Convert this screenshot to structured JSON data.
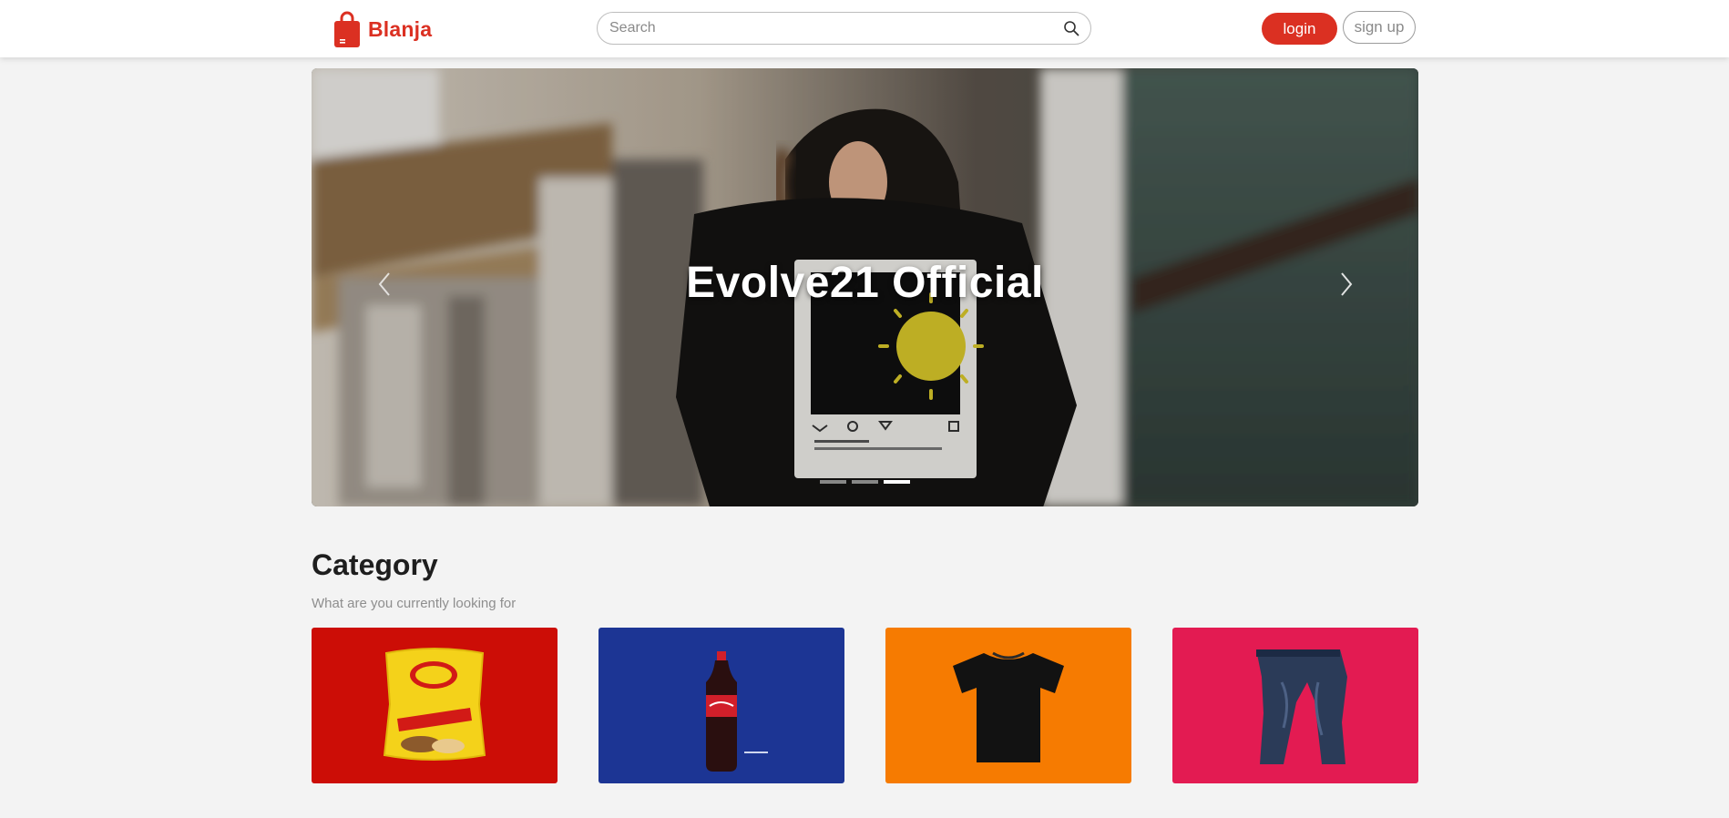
{
  "navbar": {
    "brand_name": "Blanja",
    "brand_icon": "shopping-bag-icon",
    "search": {
      "placeholder": "Search",
      "value": "",
      "icon": "search-icon"
    },
    "login_label": "login",
    "signup_label": "sign up"
  },
  "carousel": {
    "caption": "Evolve21 Official",
    "prev_icon": "chevron-left-icon",
    "next_icon": "chevron-right-icon",
    "slide_count": 3,
    "active_slide": 3
  },
  "category": {
    "title": "Category",
    "subtitle": "What are you currently looking for",
    "items": [
      {
        "name": "snacks",
        "color": "#cc0d06"
      },
      {
        "name": "drinks",
        "color": "#1c3594"
      },
      {
        "name": "t-shirt",
        "color": "#f67b01"
      },
      {
        "name": "jeans",
        "color": "#e31b52"
      }
    ]
  },
  "colors": {
    "brand": "#db3022",
    "background": "#f3f3f3",
    "navbar": "#ffffff"
  }
}
